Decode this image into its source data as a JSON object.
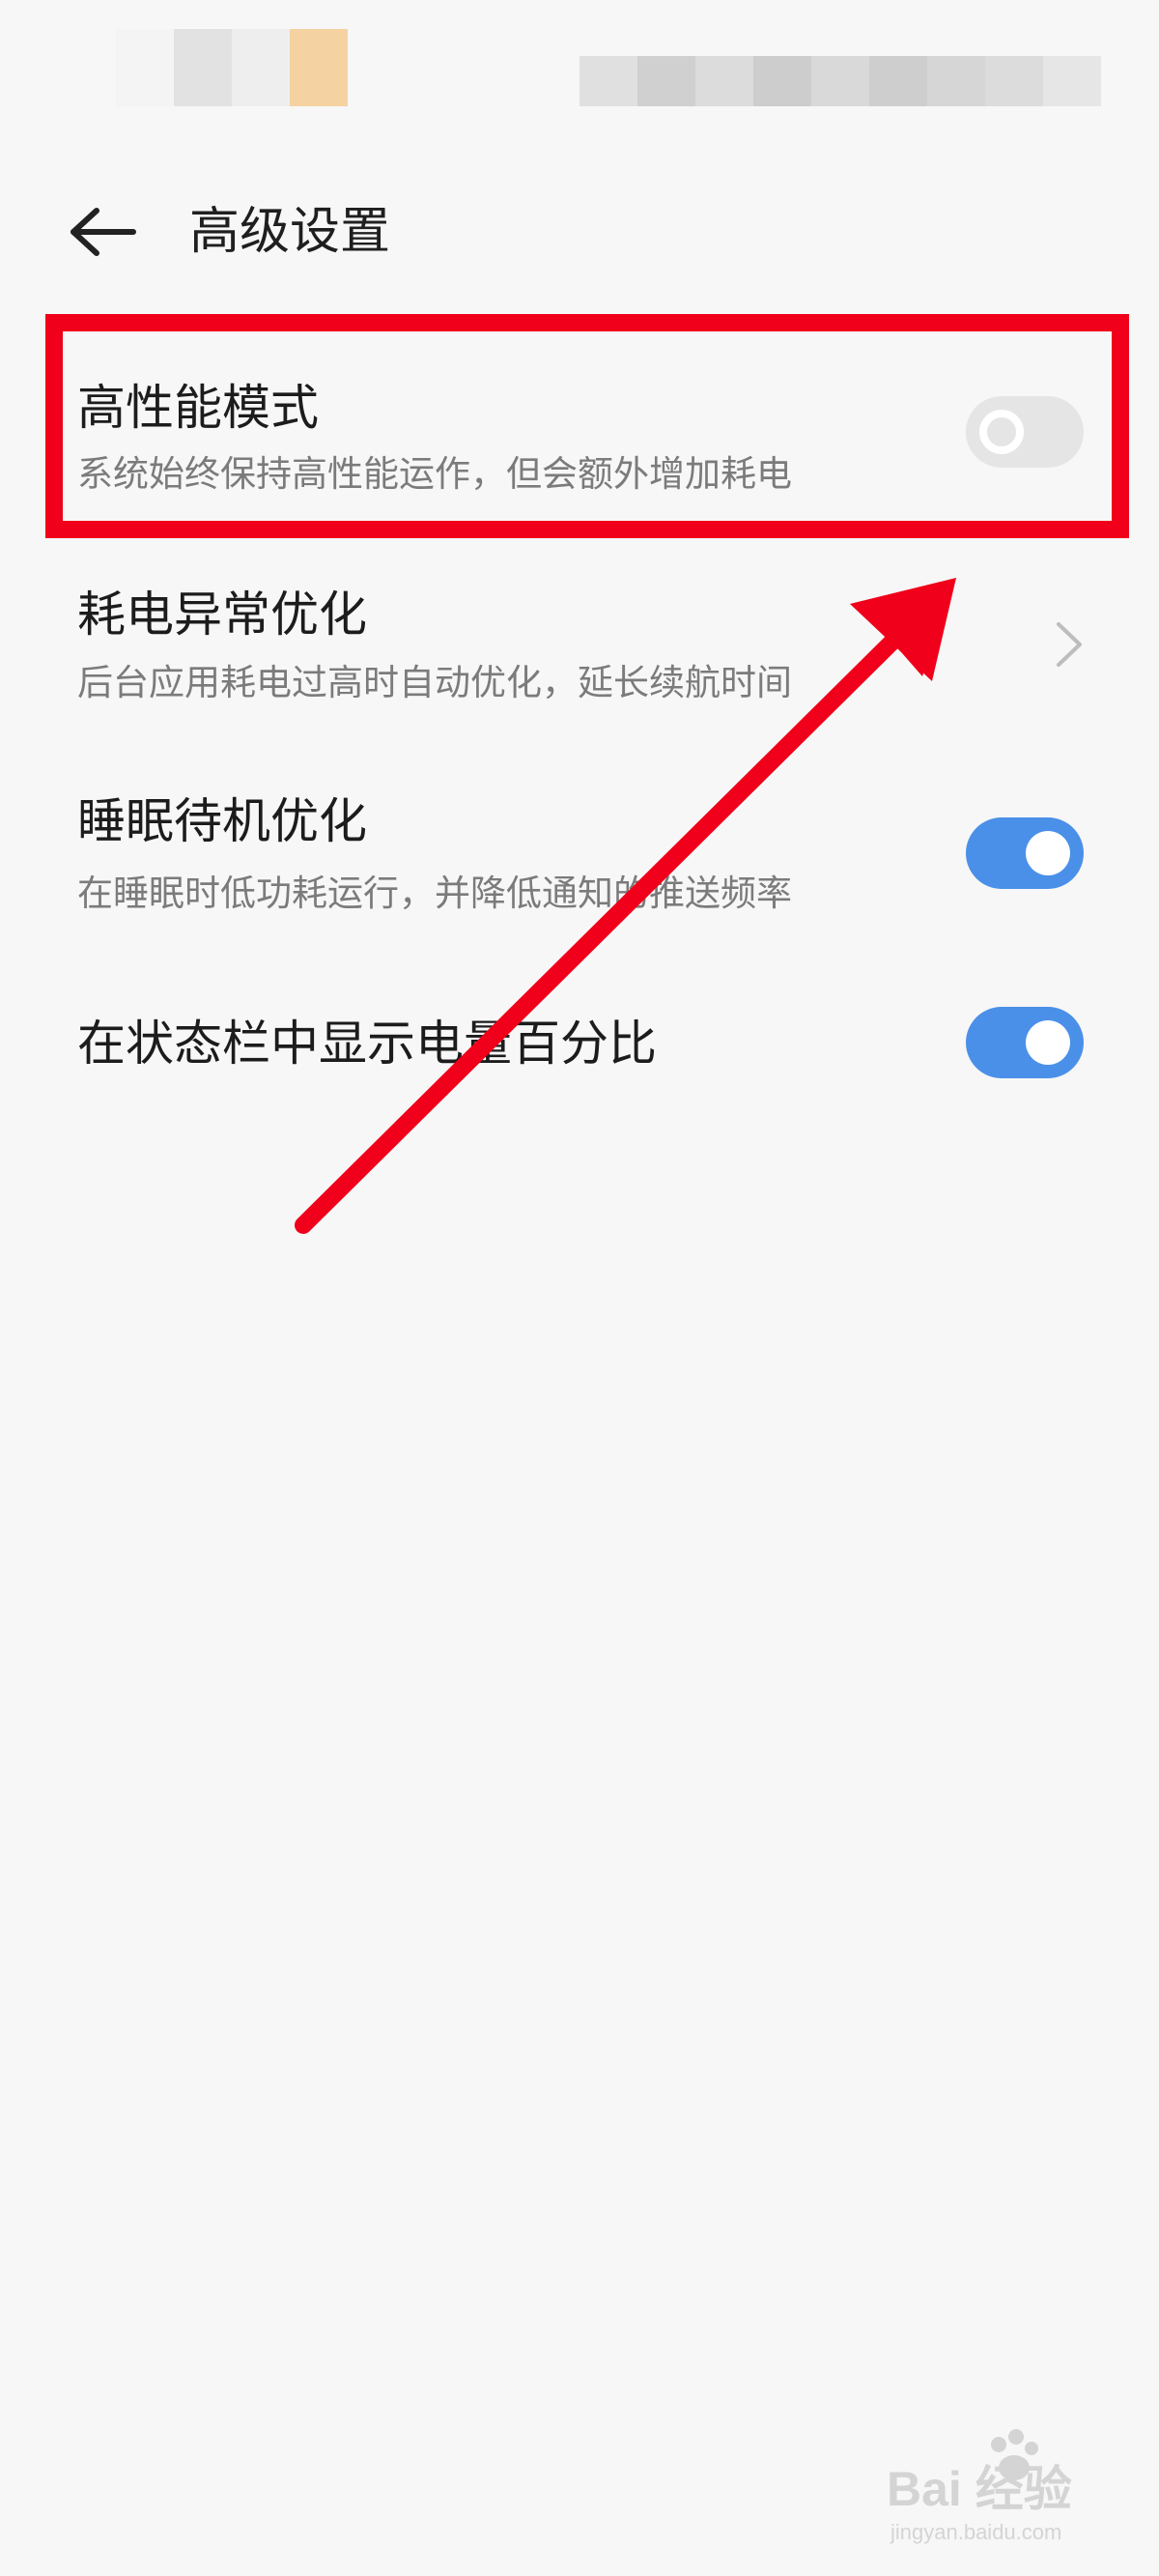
{
  "header": {
    "title": "高级设置",
    "back_icon": "arrow-left-icon"
  },
  "settings": [
    {
      "title": "高性能模式",
      "subtitle": "系统始终保持高性能运作，但会额外增加耗电",
      "control": "toggle",
      "enabled": false
    },
    {
      "title": "耗电异常优化",
      "subtitle": "后台应用耗电过高时自动优化，延长续航时间",
      "control": "chevron-right-icon"
    },
    {
      "title": "睡眠待机优化",
      "subtitle": "在睡眠时低功耗运行，并降低通知的推送频率",
      "control": "toggle",
      "enabled": true
    },
    {
      "title": "在状态栏中显示电量百分比",
      "control": "toggle",
      "enabled": true
    }
  ],
  "colors": {
    "background": "#f7f7f7",
    "toggle_on": "#4a90e8",
    "toggle_off": "#e5e5e5",
    "annotation_red": "#f0001a"
  },
  "watermark": {
    "text": "Bai 经验",
    "sub": "jingyan.baidu.com"
  }
}
